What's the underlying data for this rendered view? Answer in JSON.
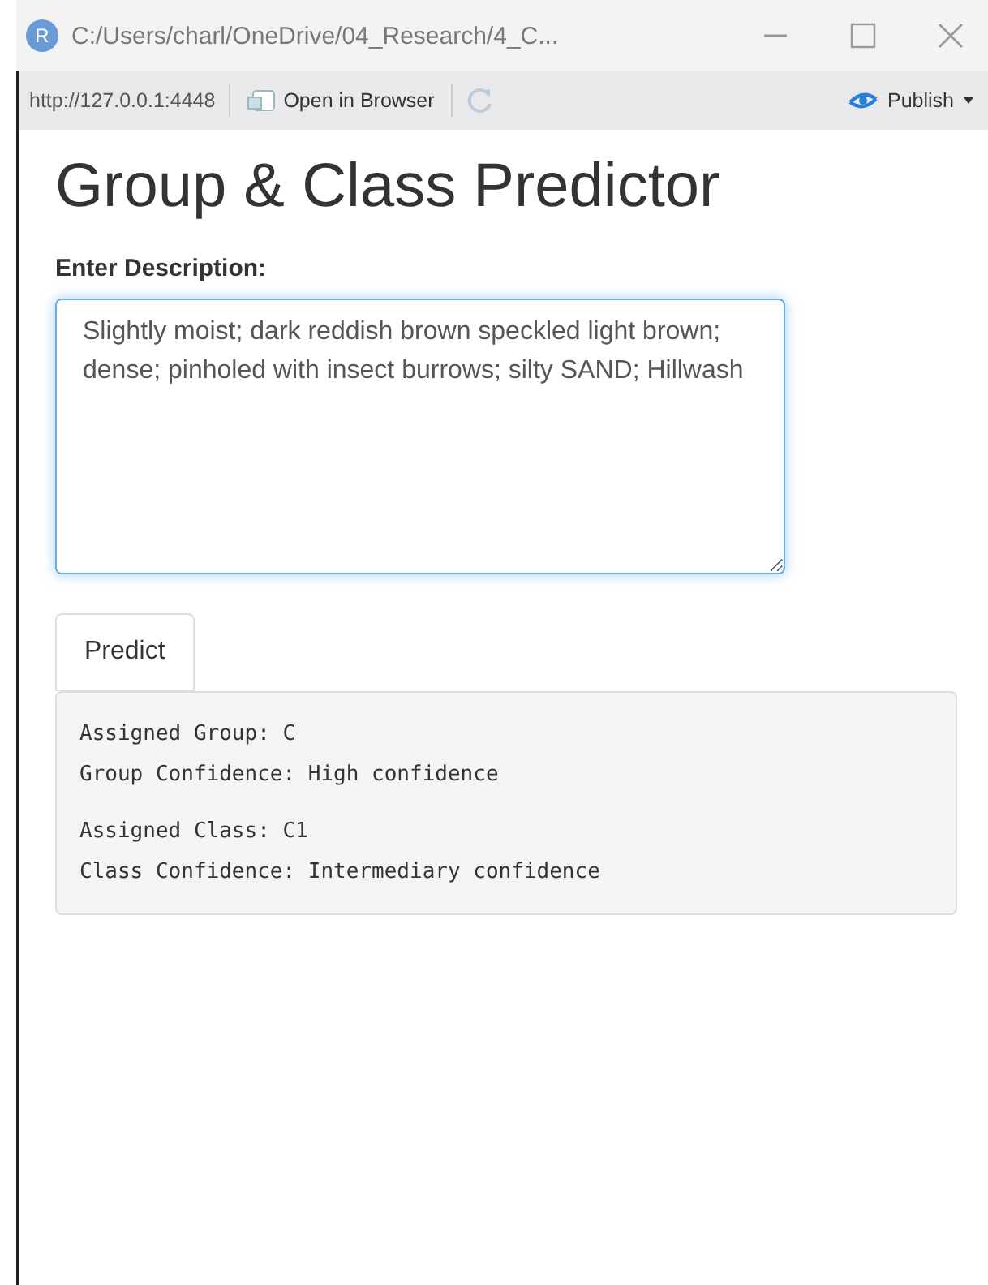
{
  "window": {
    "icon_letter": "R",
    "title": "C:/Users/charl/OneDrive/04_Research/4_C..."
  },
  "toolbar": {
    "url": "http://127.0.0.1:4448",
    "open_button": "Open in Browser",
    "publish_button": "Publish"
  },
  "page": {
    "heading": "Group & Class Predictor",
    "field_label": "Enter Description:",
    "description": "Slightly moist; dark reddish brown speckled light brown; dense; pinholed with insect burrows; silty SAND; Hillwash",
    "predict_button": "Predict",
    "output_blocks": [
      {
        "lines": [
          "Assigned Group: C",
          "Group Confidence: High confidence"
        ]
      },
      {
        "lines": [
          "Assigned Class: C1",
          "Class Confidence: Intermediary confidence"
        ]
      }
    ]
  }
}
